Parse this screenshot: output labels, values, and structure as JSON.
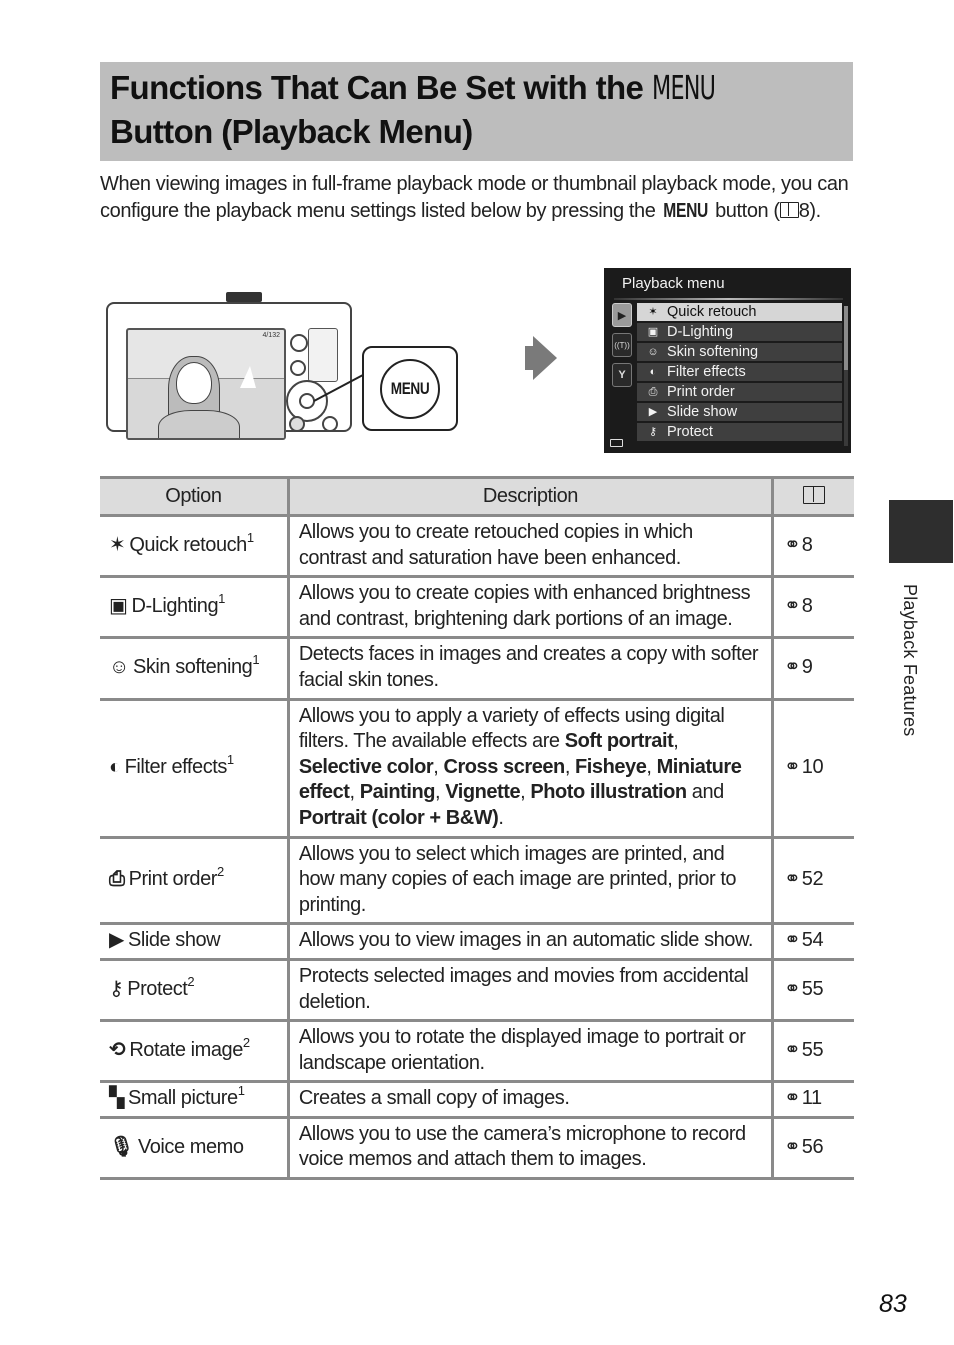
{
  "header": {
    "title_part1": "Functions That Can Be Set with the ",
    "title_menu_word": "MENU",
    "title_part2": "Button (Playback Menu)"
  },
  "intro": {
    "text_before": "When viewing images in full-frame playback mode or thumbnail playback mode, you can configure the playback menu settings listed below by pressing the ",
    "menu_word": "MENU",
    "text_mid": " button (",
    "page_ref": "8",
    "text_after": ")."
  },
  "illustration": {
    "camera_screen_counter": "4/132",
    "callout_button_label": "MENU",
    "arrow_icon": "right-arrow-icon"
  },
  "playback_menu_screen": {
    "title": "Playback menu",
    "tabs": [
      {
        "icon": "playback-icon",
        "glyph": "▶",
        "active": true
      },
      {
        "icon": "wireless-icon",
        "glyph": "((·))",
        "active": false
      },
      {
        "icon": "wrench-icon",
        "glyph": "🔧",
        "active": false
      }
    ],
    "items": [
      {
        "icon": "quick-retouch-icon",
        "glyph": "✶",
        "label": "Quick retouch",
        "selected": true
      },
      {
        "icon": "d-lighting-icon",
        "glyph": "▣",
        "label": "D-Lighting",
        "selected": false
      },
      {
        "icon": "skin-softening-icon",
        "glyph": "☺",
        "label": "Skin softening",
        "selected": false
      },
      {
        "icon": "filter-effects-icon",
        "glyph": "◐",
        "label": "Filter effects",
        "selected": false
      },
      {
        "icon": "print-order-icon",
        "glyph": "⎙",
        "label": "Print order",
        "selected": false
      },
      {
        "icon": "slide-show-icon",
        "glyph": "▶",
        "label": "Slide show",
        "selected": false
      },
      {
        "icon": "protect-icon",
        "glyph": "⚷",
        "label": "Protect",
        "selected": false
      }
    ]
  },
  "table": {
    "headers": {
      "option": "Option",
      "description": "Description",
      "reference_icon": "book-icon"
    },
    "rows": [
      {
        "icon": "quick-retouch-icon",
        "glyph": "✶",
        "option": "Quick retouch",
        "note": "1",
        "description": "Allows you to create retouched copies in which contrast and saturation have been enhanced.",
        "ref_icon": "binoculars-icon",
        "ref": "8"
      },
      {
        "icon": "d-lighting-icon",
        "glyph": "▣",
        "option": "D-Lighting",
        "note": "1",
        "description": "Allows you to create copies with enhanced brightness and contrast, brightening dark portions of an image.",
        "ref_icon": "binoculars-icon",
        "ref": "8"
      },
      {
        "icon": "skin-softening-icon",
        "glyph": "☺",
        "option": "Skin softening",
        "note": "1",
        "description": "Detects faces in images and creates a copy with softer facial skin tones.",
        "ref_icon": "binoculars-icon",
        "ref": "9"
      },
      {
        "icon": "filter-effects-icon",
        "glyph": "◐",
        "option": "Filter effects",
        "note": "1",
        "description_parts": [
          {
            "text": "Allows you to apply a variety of effects using digital filters. The available effects are ",
            "bold": false
          },
          {
            "text": "Soft portrait",
            "bold": true
          },
          {
            "text": ", ",
            "bold": false
          },
          {
            "text": "Selective color",
            "bold": true
          },
          {
            "text": ", ",
            "bold": false
          },
          {
            "text": "Cross screen",
            "bold": true
          },
          {
            "text": ", ",
            "bold": false
          },
          {
            "text": "Fisheye",
            "bold": true
          },
          {
            "text": ", ",
            "bold": false
          },
          {
            "text": "Miniature effect",
            "bold": true
          },
          {
            "text": ", ",
            "bold": false
          },
          {
            "text": "Painting",
            "bold": true
          },
          {
            "text": ", ",
            "bold": false
          },
          {
            "text": "Vignette",
            "bold": true
          },
          {
            "text": ", ",
            "bold": false
          },
          {
            "text": "Photo illustration",
            "bold": true
          },
          {
            "text": " and ",
            "bold": false
          },
          {
            "text": "Portrait (color + B&W)",
            "bold": true
          },
          {
            "text": ".",
            "bold": false
          }
        ],
        "ref_icon": "binoculars-icon",
        "ref": "10"
      },
      {
        "icon": "print-order-icon",
        "glyph": "⎙",
        "option": "Print order",
        "note": "2",
        "description": "Allows you to select which images are printed, and how many copies of each image are printed, prior to printing.",
        "ref_icon": "binoculars-icon",
        "ref": "52"
      },
      {
        "icon": "slide-show-icon",
        "glyph": "▶",
        "option": "Slide show",
        "note": "",
        "description": "Allows you to view images in an automatic slide show.",
        "ref_icon": "binoculars-icon",
        "ref": "54"
      },
      {
        "icon": "protect-icon",
        "glyph": "⚷",
        "option": "Protect",
        "note": "2",
        "description": "Protects selected images and movies from accidental deletion.",
        "ref_icon": "binoculars-icon",
        "ref": "55"
      },
      {
        "icon": "rotate-image-icon",
        "glyph": "⟲",
        "option": "Rotate image",
        "note": "2",
        "description": "Allows you to rotate the displayed image to portrait or landscape orientation.",
        "ref_icon": "binoculars-icon",
        "ref": "55"
      },
      {
        "icon": "small-picture-icon",
        "glyph": "▚",
        "option": "Small picture",
        "note": "1",
        "description": "Creates a small copy of images.",
        "ref_icon": "binoculars-icon",
        "ref": "11"
      },
      {
        "icon": "voice-memo-icon",
        "glyph": "🎙",
        "option": "Voice memo",
        "note": "",
        "description": "Allows you to use the camera’s microphone to record voice memos and attach them to images.",
        "ref_icon": "binoculars-icon",
        "ref": "56"
      }
    ]
  },
  "side_tab": {
    "label": "Playback Features"
  },
  "footer": {
    "page_number": "83"
  }
}
